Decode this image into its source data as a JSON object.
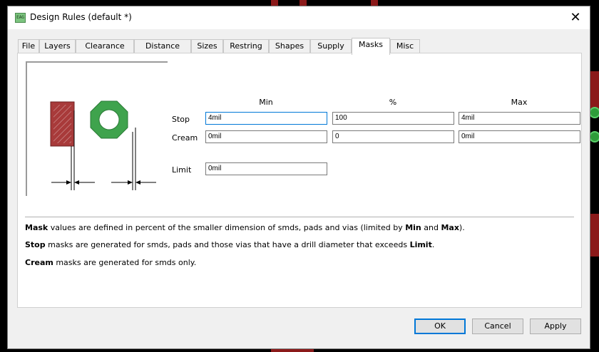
{
  "window": {
    "title": "Design Rules (default *)",
    "close_glyph": "✕",
    "icon_label": "EAG"
  },
  "tabs": [
    {
      "label": "File"
    },
    {
      "label": "Layers"
    },
    {
      "label": "Clearance"
    },
    {
      "label": "Distance"
    },
    {
      "label": "Sizes"
    },
    {
      "label": "Restring"
    },
    {
      "label": "Shapes"
    },
    {
      "label": "Supply"
    },
    {
      "label": "Masks"
    },
    {
      "label": "Misc"
    }
  ],
  "active_tab": "Masks",
  "masks": {
    "headers": {
      "min": "Min",
      "percent": "%",
      "max": "Max"
    },
    "stop": {
      "label": "Stop",
      "min": "4mil",
      "percent": "100",
      "max": "4mil"
    },
    "cream": {
      "label": "Cream",
      "min": "0mil",
      "percent": "0",
      "max": "0mil"
    },
    "limit": {
      "label": "Limit",
      "value": "0mil"
    }
  },
  "notes": {
    "line1": {
      "b1": "Mask",
      "t1": " values are defined in percent of the smaller dimension of smds, pads and vias (limited by ",
      "b2": "Min",
      "t2": " and ",
      "b3": "Max",
      "t3": ")."
    },
    "line2": {
      "b1": "Stop",
      "t1": " masks are generated for smds, pads and those vias that have a drill diameter that exceeds ",
      "b2": "Limit",
      "t2": "."
    },
    "line3": {
      "b1": "Cream",
      "t1": " masks are generated for smds only."
    }
  },
  "buttons": {
    "ok": "OK",
    "cancel": "Cancel",
    "apply": "Apply"
  },
  "colors": {
    "smd_fill": "#a83a3a",
    "pad_fill": "#3fa34d",
    "focus": "#0078d7",
    "board_trace": "#8b1a1a"
  }
}
